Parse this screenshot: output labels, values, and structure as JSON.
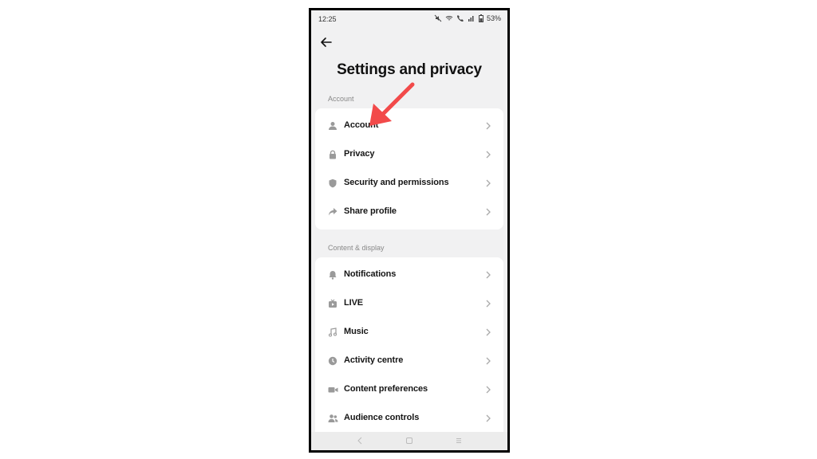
{
  "status_bar": {
    "time": "12:25",
    "battery": "53%"
  },
  "header": {
    "title": "Settings and privacy"
  },
  "sections": [
    {
      "label": "Account",
      "items": [
        {
          "label": "Account",
          "icon": "person-icon"
        },
        {
          "label": "Privacy",
          "icon": "lock-icon"
        },
        {
          "label": "Security and permissions",
          "icon": "shield-icon"
        },
        {
          "label": "Share profile",
          "icon": "share-icon"
        }
      ]
    },
    {
      "label": "Content & display",
      "items": [
        {
          "label": "Notifications",
          "icon": "bell-icon"
        },
        {
          "label": "LIVE",
          "icon": "tv-icon"
        },
        {
          "label": "Music",
          "icon": "music-note-icon"
        },
        {
          "label": "Activity centre",
          "icon": "clock-icon"
        },
        {
          "label": "Content preferences",
          "icon": "video-camera-icon"
        },
        {
          "label": "Audience controls",
          "icon": "people-icon"
        }
      ]
    }
  ],
  "annotation": {
    "color": "#f24a4a",
    "icon": "red-arrow-icon"
  },
  "colors": {
    "screen_bg": "#f1f1f2",
    "card_bg": "#ffffff",
    "text": "#161616",
    "muted": "#888888"
  }
}
